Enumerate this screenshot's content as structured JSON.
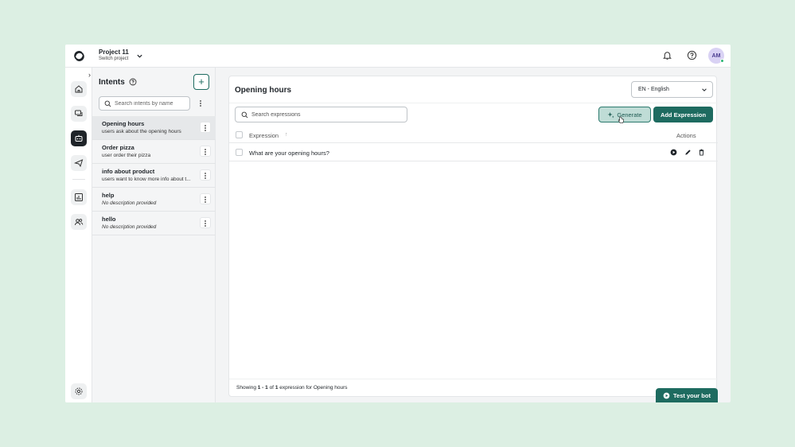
{
  "header": {
    "project_name": "Project 11",
    "project_sub": "Switch project",
    "avatar_initials": "AM"
  },
  "intents_panel": {
    "title": "Intents",
    "search_placeholder": "Search intents by name",
    "items": [
      {
        "name": "Opening hours",
        "desc": "users ask about the opening hours",
        "selected": true
      },
      {
        "name": "Order pizza",
        "desc": "user order their pizza"
      },
      {
        "name": "info about product",
        "desc": "users want to know more info about t..."
      },
      {
        "name": "help",
        "desc": "No description provided"
      },
      {
        "name": "hello",
        "desc": "No description provided"
      }
    ]
  },
  "main": {
    "title": "Opening hours",
    "language": "EN - English",
    "search_placeholder": "Search expressions",
    "generate_label": "Generate",
    "add_expression_label": "Add Expression",
    "table": {
      "col_expression": "Expression",
      "col_actions": "Actions",
      "rows": [
        {
          "expression": "What are your opening hours?"
        }
      ]
    },
    "footer": {
      "prefix": "Showing ",
      "range": "1 - 1",
      "mid": " of ",
      "total": "1",
      "suffix": " expression for Opening hours"
    }
  },
  "test_bot_label": "Test your bot",
  "colors": {
    "accent": "#1e6b60",
    "background": "#dcefe3"
  }
}
